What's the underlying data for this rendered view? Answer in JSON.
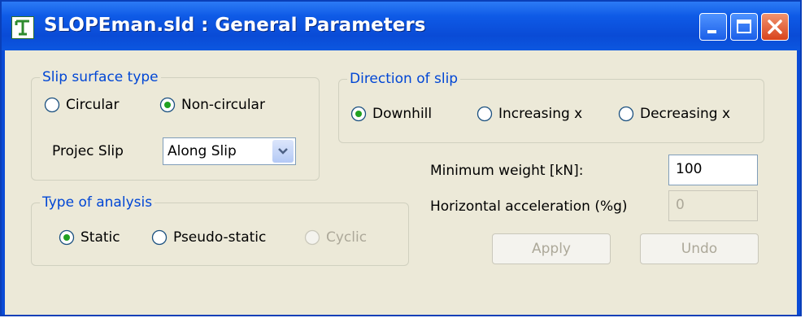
{
  "window": {
    "title": "SLOPEman.sld : General Parameters"
  },
  "slip_surface": {
    "legend": "Slip surface type",
    "options": [
      "Circular",
      "Non-circular"
    ],
    "selected": "Non-circular",
    "projec_label": "Projec Slip",
    "projec_value": "Along Slip"
  },
  "direction": {
    "legend": "Direction of slip",
    "options": [
      "Downhill",
      "Increasing x",
      "Decreasing x"
    ],
    "selected": "Downhill"
  },
  "analysis": {
    "legend": "Type of analysis",
    "options": [
      "Static",
      "Pseudo-static",
      "Cyclic"
    ],
    "selected": "Static",
    "disabled": [
      "Cyclic"
    ]
  },
  "params": {
    "min_weight_label": "Minimum weight [kN]:",
    "min_weight_value": "100",
    "horiz_accel_label": "Horizontal acceleration (%g)",
    "horiz_accel_value": "0"
  },
  "buttons": {
    "apply": "Apply",
    "undo": "Undo"
  },
  "colors": {
    "titlebar": "#0A4BD6",
    "client": "#ECE9D8",
    "legend_text": "#0046D5",
    "close_button": "#D8431C"
  }
}
